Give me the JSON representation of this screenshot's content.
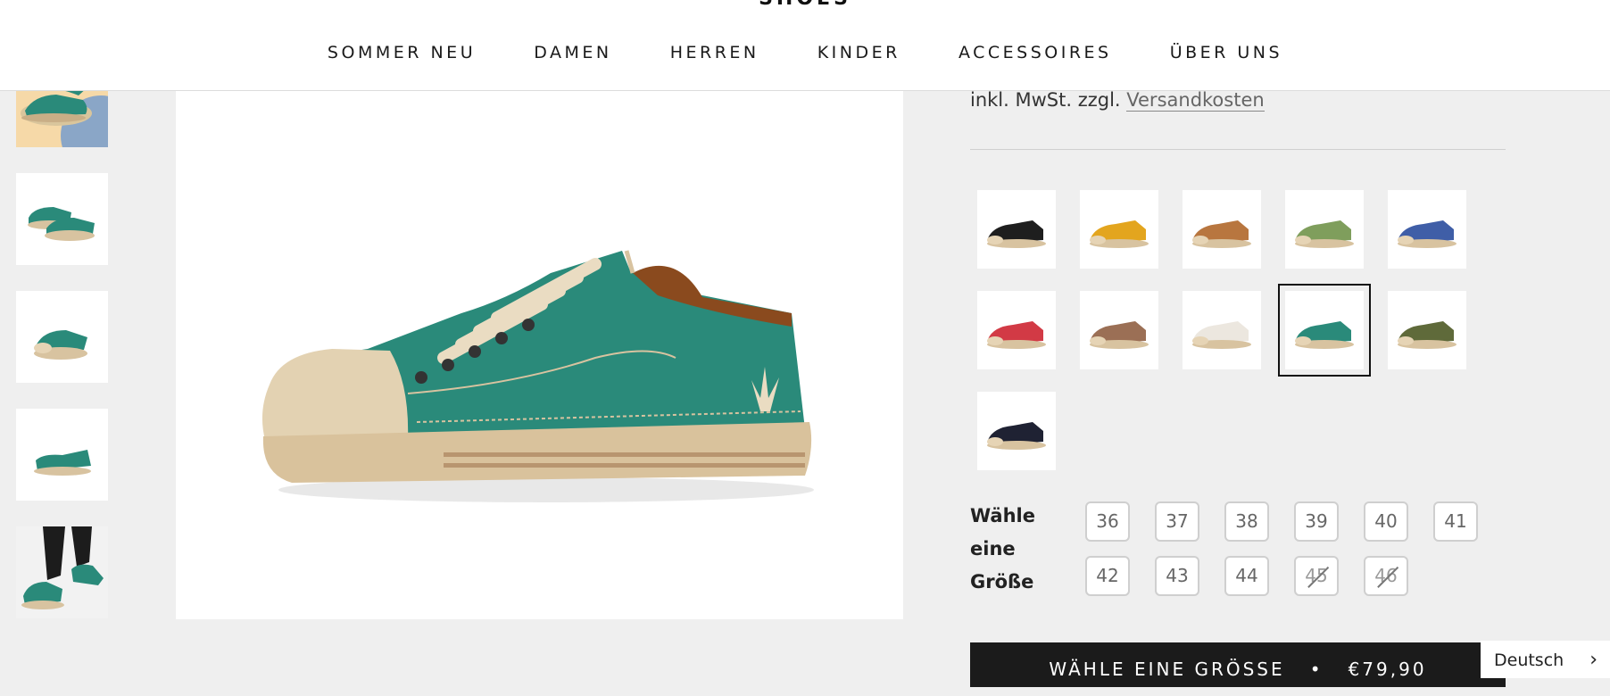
{
  "header": {
    "brand": "SHOES",
    "nav": [
      "SOMMER NEU",
      "DAMEN",
      "HERREN",
      "KINDER",
      "ACCESSOIRES",
      "ÜBER UNS"
    ]
  },
  "gallery": {
    "thumbnails": [
      "lifestyle-feet-floor",
      "pair-side",
      "single-front",
      "single-side-small",
      "lifestyle-walking"
    ],
    "main_image": "green-canvas-sneaker-side"
  },
  "product": {
    "tax_prefix": "inkl. MwSt. zzgl.",
    "shipping_link": "Versandkosten",
    "colors": [
      {
        "name": "black",
        "hex": "#1e1e1e"
      },
      {
        "name": "mustard",
        "hex": "#e3a51e"
      },
      {
        "name": "cognac",
        "hex": "#b8763f"
      },
      {
        "name": "sage",
        "hex": "#7f9e5c"
      },
      {
        "name": "blue",
        "hex": "#3f5ea7"
      },
      {
        "name": "red",
        "hex": "#d23a45"
      },
      {
        "name": "brown",
        "hex": "#9b6f55"
      },
      {
        "name": "off-white",
        "hex": "#ece7df"
      },
      {
        "name": "teal",
        "hex": "#2a8a7a"
      },
      {
        "name": "olive",
        "hex": "#5f6a3a"
      },
      {
        "name": "navy",
        "hex": "#1f2233"
      }
    ],
    "selected_color": "teal",
    "size_label_lines": [
      "Wähle",
      "eine",
      "Größe"
    ],
    "sizes": [
      {
        "label": "36",
        "sold_out": false
      },
      {
        "label": "37",
        "sold_out": false
      },
      {
        "label": "38",
        "sold_out": false
      },
      {
        "label": "39",
        "sold_out": false
      },
      {
        "label": "40",
        "sold_out": false
      },
      {
        "label": "41",
        "sold_out": false
      },
      {
        "label": "42",
        "sold_out": false
      },
      {
        "label": "43",
        "sold_out": false
      },
      {
        "label": "44",
        "sold_out": false
      },
      {
        "label": "45",
        "sold_out": true
      },
      {
        "label": "46",
        "sold_out": true
      }
    ],
    "cta_label": "WÄHLE EINE GRÖSSE",
    "cta_separator": "•",
    "price": "€79,90"
  },
  "language": {
    "label": "Deutsch",
    "chevron": "chevron-right-icon"
  }
}
